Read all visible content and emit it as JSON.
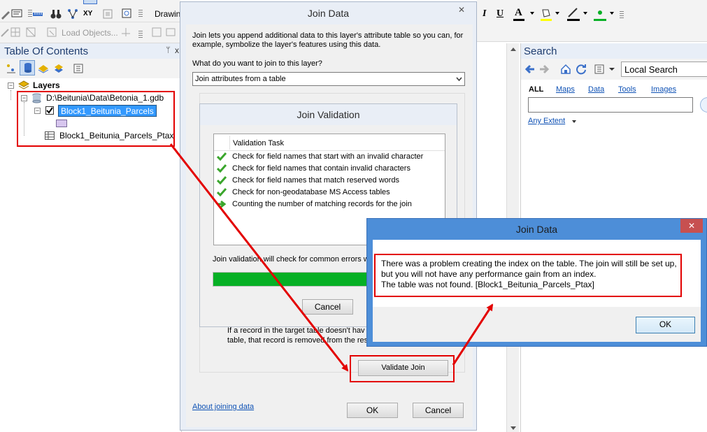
{
  "toolbar": {
    "drawing_label": "Drawin",
    "load_objects_label": "Load Objects...",
    "xy_label": "XY"
  },
  "toc": {
    "title": "Table Of Contents",
    "pin": "ᐅ",
    "close": "x",
    "layers_label": "Layers",
    "gdb_path": "D:\\Beitunia\\Data\\Betonia_1.gdb",
    "layer_name": "Block1_Beitunia_Parcels",
    "table_name": "Block1_Beitunia_Parcels_Ptax"
  },
  "join_dialog": {
    "title": "Join Data",
    "close": "✕",
    "intro": "Join lets you append additional data to this layer's attribute table so you can, for example, symbolize the layer's features using this data.",
    "question": "What do you want to join to this layer?",
    "dropdown_value": "Join attributes from a table",
    "partial_text_1": "If a record in the target table doesn't hav",
    "partial_text_2": "table, that record is removed from the res",
    "validate_label": "Validate Join",
    "about_link": "About joining data",
    "ok_label": "OK",
    "cancel_label": "Cancel"
  },
  "validation": {
    "title": "Join Validation",
    "column_header": "Validation Task",
    "tasks": [
      "Check for field names that start with an invalid character",
      "Check for field names that contain invalid characters",
      "Check for field names that match reserved words",
      "Check for non-geodatabase MS Access tables",
      "Counting the number of matching records for the join"
    ],
    "status_text": "Join validation will check for common errors wh",
    "cancel_label": "Cancel",
    "progress_fraction": 1.0
  },
  "error_dialog": {
    "title": "Join Data",
    "close": "✕",
    "message_1": "There was a problem creating the index on the table. The join will still be set up,",
    "message_2": "but you will not have any performance gain from an index.",
    "message_3": "The table was not found. [Block1_Beitunia_Parcels_Ptax]",
    "ok_label": "OK"
  },
  "search": {
    "title": "Search",
    "scope": "Local Search",
    "tabs": [
      "ALL",
      "Maps",
      "Data",
      "Tools",
      "Images"
    ],
    "extent": "Any Extent"
  },
  "colors": {
    "accent_blue": "#3a7fd5",
    "annotation_red": "#e30000",
    "progress_green": "#06b025",
    "selection_blue": "#3399ff"
  }
}
